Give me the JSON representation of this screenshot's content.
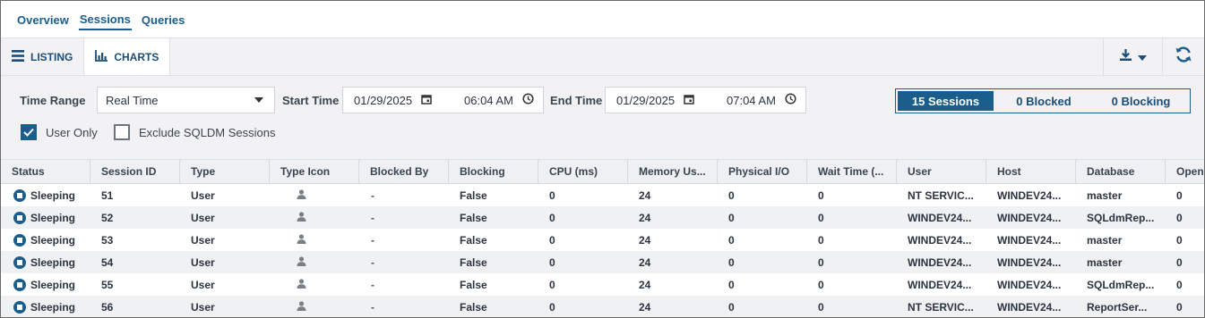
{
  "top_tabs": [
    {
      "label": "Overview"
    },
    {
      "label": "Sessions"
    },
    {
      "label": "Queries"
    }
  ],
  "toolbar": {
    "listing_label": "LISTING",
    "charts_label": "CHARTS"
  },
  "filters": {
    "time_range_label": "Time Range",
    "time_range_value": "Real Time",
    "start_time_label": "Start Time",
    "start_date": "01/29/2025",
    "start_time": "06:04 AM",
    "end_time_label": "End Time",
    "end_date": "01/29/2025",
    "end_time": "07:04 AM",
    "user_only_label": "User Only",
    "user_only_checked": true,
    "exclude_label": "Exclude SQLDM Sessions",
    "exclude_checked": false
  },
  "counts": {
    "sessions": "15 Sessions",
    "blocked": "0 Blocked",
    "blocking": "0 Blocking"
  },
  "colors": {
    "accent": "#1b5e8c",
    "toolbar_bg": "#f2f2f4"
  },
  "table": {
    "headers": [
      "Status",
      "Session ID",
      "Type",
      "Type Icon",
      "Blocked By",
      "Blocking",
      "CPU (ms)",
      "Memory Us...",
      "Physical I/O",
      "Wait Time (...",
      "User",
      "Host",
      "Database",
      "Open"
    ],
    "rows": [
      {
        "status": "Sleeping",
        "session_id": "51",
        "type": "User",
        "type_icon": "user-icon",
        "blocked_by": "-",
        "blocking": "False",
        "cpu": "0",
        "memory": "24",
        "physical_io": "0",
        "wait_time": "0",
        "user": "NT SERVIC...",
        "host": "WINDEV24...",
        "database": "master",
        "open": "0"
      },
      {
        "status": "Sleeping",
        "session_id": "52",
        "type": "User",
        "type_icon": "user-icon",
        "blocked_by": "-",
        "blocking": "False",
        "cpu": "0",
        "memory": "24",
        "physical_io": "0",
        "wait_time": "0",
        "user": "WINDEV24...",
        "host": "WINDEV24...",
        "database": "SQLdmRep...",
        "open": "0"
      },
      {
        "status": "Sleeping",
        "session_id": "53",
        "type": "User",
        "type_icon": "user-icon",
        "blocked_by": "-",
        "blocking": "False",
        "cpu": "0",
        "memory": "24",
        "physical_io": "0",
        "wait_time": "0",
        "user": "WINDEV24...",
        "host": "WINDEV24...",
        "database": "master",
        "open": "0"
      },
      {
        "status": "Sleeping",
        "session_id": "54",
        "type": "User",
        "type_icon": "user-icon",
        "blocked_by": "-",
        "blocking": "False",
        "cpu": "0",
        "memory": "24",
        "physical_io": "0",
        "wait_time": "0",
        "user": "WINDEV24...",
        "host": "WINDEV24...",
        "database": "master",
        "open": "0"
      },
      {
        "status": "Sleeping",
        "session_id": "55",
        "type": "User",
        "type_icon": "user-icon",
        "blocked_by": "-",
        "blocking": "False",
        "cpu": "0",
        "memory": "24",
        "physical_io": "0",
        "wait_time": "0",
        "user": "WINDEV24...",
        "host": "WINDEV24...",
        "database": "SQLdmRep...",
        "open": "0"
      },
      {
        "status": "Sleeping",
        "session_id": "56",
        "type": "User",
        "type_icon": "user-icon",
        "blocked_by": "-",
        "blocking": "False",
        "cpu": "0",
        "memory": "24",
        "physical_io": "0",
        "wait_time": "0",
        "user": "NT SERVIC...",
        "host": "WINDEV24...",
        "database": "ReportSer...",
        "open": "0"
      }
    ]
  }
}
